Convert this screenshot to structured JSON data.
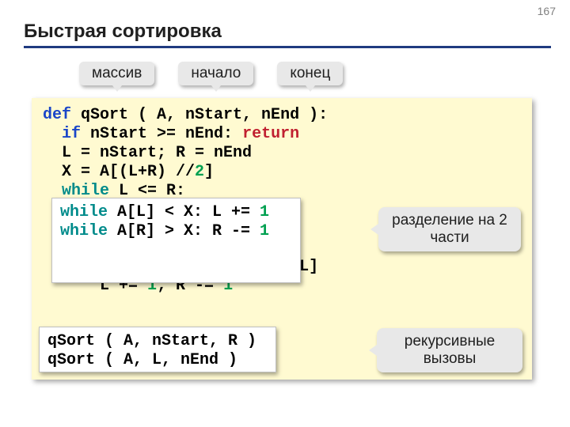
{
  "page_number": "167",
  "title": "Быстрая сортировка",
  "labels": {
    "arr": "массив",
    "start": "начало",
    "end": "конец"
  },
  "code": {
    "l1": {
      "def": "def",
      "fn": " qSort",
      "rest": " ( A, nStart, nEnd ):"
    },
    "l2": {
      "ind": "  ",
      "if": "if",
      "cond": " nStart >= nEnd: ",
      "ret": "return"
    },
    "l3": "  L = nStart; R = nEnd",
    "l4": {
      "pre": "  X = A[(L+R) //",
      "num": "2",
      "post": "]"
    },
    "l5": {
      "ind": "  ",
      "while": "while",
      "cond": " L <= R:"
    },
    "box1": {
      "bl1": {
        "while": "while",
        "mid": " A[L] < X: L += ",
        "num": "1"
      },
      "bl2": {
        "while": "while",
        "mid": " A[R] > X: R -= ",
        "num": "1"
      }
    },
    "l6tail": "L]",
    "l7": {
      "pre": "      L += ",
      "n1": "1",
      "mid": "; R -= ",
      "n2": "1"
    },
    "box2": {
      "r1": "qSort ( A, nStart, R )",
      "r2": "qSort ( A, L, nEnd )"
    }
  },
  "callouts": {
    "split": "разделение\nна 2 части",
    "rec": "рекурсивные\nвызовы"
  }
}
